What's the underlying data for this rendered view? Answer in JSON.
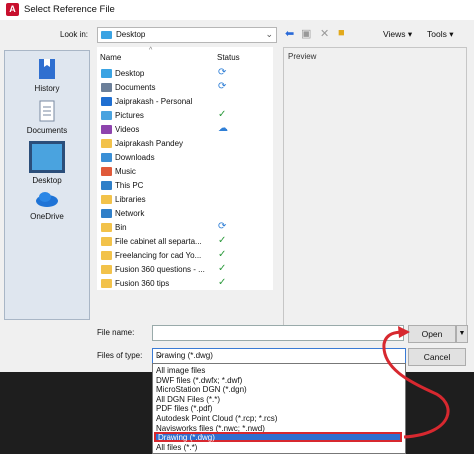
{
  "window": {
    "title": "Select Reference File"
  },
  "lookin": {
    "label": "Look in:",
    "value": "Desktop"
  },
  "toolbar": {
    "views_label": "Views",
    "tools_label": "Tools"
  },
  "places": [
    {
      "label": "History"
    },
    {
      "label": "Documents"
    },
    {
      "label": "Desktop"
    },
    {
      "label": "OneDrive"
    }
  ],
  "filelist": {
    "col_name": "Name",
    "col_status": "Status",
    "items": [
      {
        "name": "Desktop",
        "status": "sync",
        "icon_color": "#3aa3e3"
      },
      {
        "name": "Documents",
        "status": "sync",
        "icon_color": "#6b7f99"
      },
      {
        "name": "Jaiprakash - Personal",
        "status": "",
        "icon_color": "#1f6fd1"
      },
      {
        "name": "Pictures",
        "status": "ok",
        "icon_color": "#4aa3df"
      },
      {
        "name": "Videos",
        "status": "cloud",
        "icon_color": "#8e44ad"
      },
      {
        "name": "Jaiprakash Pandey",
        "status": "",
        "icon_color": "#f2c24a"
      },
      {
        "name": "Downloads",
        "status": "",
        "icon_color": "#3a8fd6"
      },
      {
        "name": "Music",
        "status": "",
        "icon_color": "#e05a3a"
      },
      {
        "name": "This PC",
        "status": "",
        "icon_color": "#2f7fc8"
      },
      {
        "name": "Libraries",
        "status": "",
        "icon_color": "#f2c24a"
      },
      {
        "name": "Network",
        "status": "",
        "icon_color": "#2f7fc8"
      },
      {
        "name": "Bin",
        "status": "sync",
        "icon_color": "#f2c24a"
      },
      {
        "name": "File cabinet all separta...",
        "status": "ok",
        "icon_color": "#f2c24a"
      },
      {
        "name": "Freelancing for cad Yo...",
        "status": "ok",
        "icon_color": "#f2c24a"
      },
      {
        "name": "Fusion 360 questions - ...",
        "status": "ok",
        "icon_color": "#f2c24a"
      },
      {
        "name": "Fusion 360 tips",
        "status": "ok",
        "icon_color": "#f2c24a"
      }
    ]
  },
  "preview": {
    "label": "Preview"
  },
  "filename": {
    "label": "File name:",
    "value": ""
  },
  "filetype": {
    "label": "Files of type:",
    "value": "Drawing (*.dwg)",
    "options": [
      "All image files",
      "DWF files (*.dwfx; *.dwf)",
      "MicroStation DGN (*.dgn)",
      "All DGN Files (*.*)",
      "PDF files (*.pdf)",
      "Autodesk Point Cloud (*.rcp; *.rcs)",
      "Navisworks files (*.nwc; *.nwd)",
      "Drawing (*.dwg)",
      "All files (*.*)"
    ]
  },
  "buttons": {
    "open": "Open",
    "cancel": "Cancel"
  },
  "colors": {
    "annotation_red": "#d7282f",
    "selection_blue": "#2f6fd0",
    "accent": "#c8102e"
  }
}
